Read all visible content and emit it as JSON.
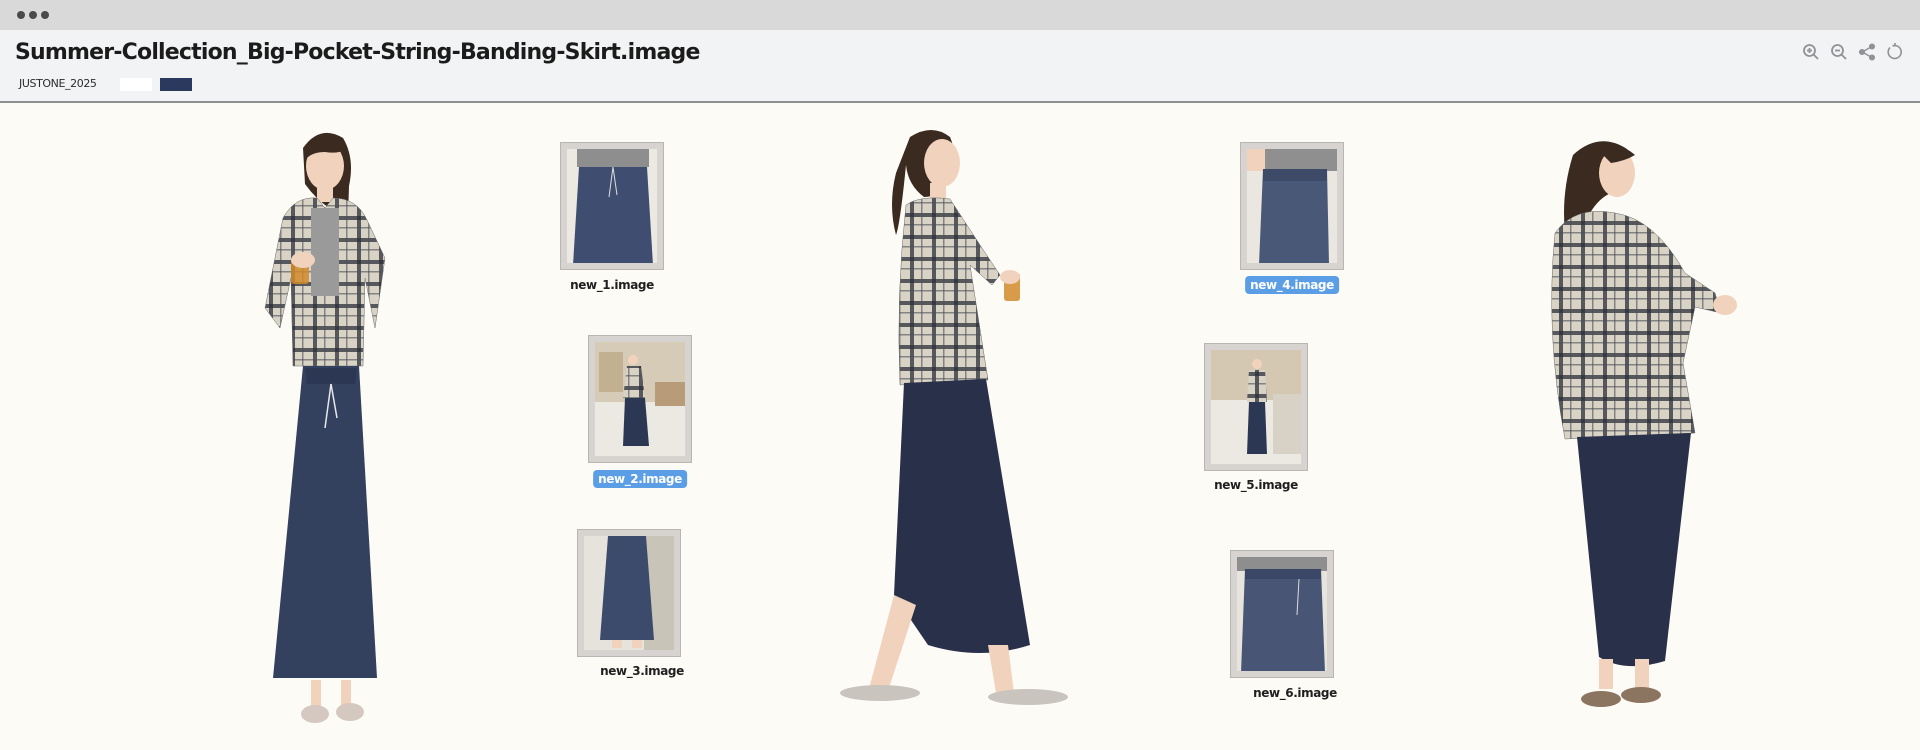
{
  "window": {
    "title": "Summer-Collection_Big-Pocket-String-Banding-Skirt.image",
    "subtitle": "JUSTONE_2025",
    "swatches": [
      "#ffffff",
      "#2a3a5e"
    ]
  },
  "toolbar": {
    "zoom_in_icon": "zoom-in-icon",
    "zoom_out_icon": "zoom-out-icon",
    "share_icon": "share-icon",
    "reset_icon": "rotate-icon"
  },
  "thumbnails": [
    {
      "label": "new_1.image",
      "selected": false
    },
    {
      "label": "new_2.image",
      "selected": true
    },
    {
      "label": "new_3.image",
      "selected": false
    },
    {
      "label": "new_4.image",
      "selected": true
    },
    {
      "label": "new_5.image",
      "selected": false
    },
    {
      "label": "new_6.image",
      "selected": false
    }
  ],
  "colors": {
    "plaid_light": "#d6d0c2",
    "plaid_dark": "#2b2f38",
    "skirt_navy": "#33405e",
    "hair": "#3a2a20",
    "skin": "#f1d3bd",
    "selection_blue": "#5c9ee6"
  }
}
